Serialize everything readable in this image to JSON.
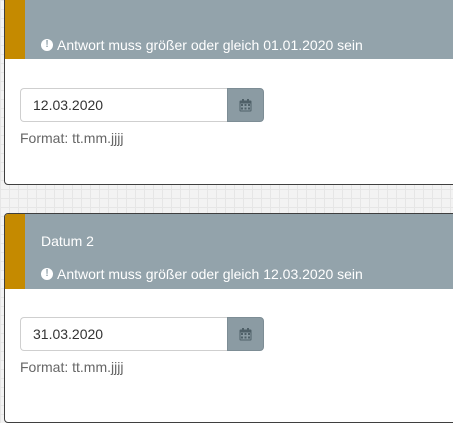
{
  "questions": [
    {
      "title": "",
      "error": "Antwort muss größer oder gleich 01.01.2020 sein",
      "value": "12.03.2020",
      "hint": "Format: tt.mm.jjjj",
      "calendar_icon": "calendar-icon",
      "error_icon": "exclamation-circle-icon"
    },
    {
      "title": "Datum 2",
      "error": "Antwort muss größer oder gleich 12.03.2020 sein",
      "value": "31.03.2020",
      "hint": "Format: tt.mm.jjjj",
      "calendar_icon": "calendar-icon",
      "error_icon": "exclamation-circle-icon"
    }
  ],
  "colors": {
    "accent": "#c58a00",
    "header": "#93a3ab",
    "button": "#8b9ba3",
    "background": "#f3f3f3"
  }
}
